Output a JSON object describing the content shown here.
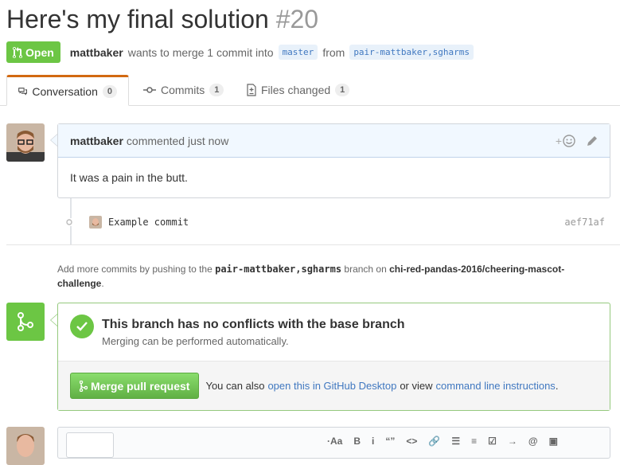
{
  "pull_request": {
    "title": "Here's my final solution",
    "number": "#20",
    "state_label": "Open",
    "author": "mattbaker",
    "summary_text": "wants to merge 1 commit into",
    "base_branch": "master",
    "from_text": "from",
    "head_branch": "pair-mattbaker,sgharms"
  },
  "tabs": [
    {
      "label": "Conversation",
      "count": "0"
    },
    {
      "label": "Commits",
      "count": "1"
    },
    {
      "label": "Files changed",
      "count": "1"
    }
  ],
  "comment": {
    "author": "mattbaker",
    "action_text": "commented just now",
    "body": "It was a pain in the butt.",
    "reaction_label": "+"
  },
  "commit": {
    "message": "Example commit",
    "sha": "aef71af"
  },
  "hint": {
    "prefix": "Add more commits by pushing to the",
    "branch": "pair-mattbaker,sgharms",
    "middle": "branch on",
    "repo": "chi-red-pandas-2016/cheering-mascot-challenge",
    "suffix": "."
  },
  "merge": {
    "status_title": "This branch has no conflicts with the base branch",
    "status_sub": "Merging can be performed automatically.",
    "button_label": "Merge pull request",
    "also_text": "You can also",
    "desktop_link": "open this in GitHub Desktop",
    "or_view_text": "or view",
    "cli_link": "command line instructions",
    "end_text": "."
  },
  "toolbar": {
    "items": [
      "·Aa",
      "B",
      "i",
      "“”",
      "<>",
      "🔗",
      "☰",
      "≡",
      "☑",
      "→",
      "@",
      "▣"
    ]
  },
  "colors": {
    "open_green": "#6cc644",
    "link_blue": "#4078c0",
    "tab_accent": "#d26911"
  },
  "icons": [
    "git-pull-request-icon",
    "comment-discussion-icon",
    "git-commit-icon",
    "diff-icon",
    "smiley-icon",
    "pencil-icon",
    "git-merge-icon",
    "check-icon"
  ]
}
